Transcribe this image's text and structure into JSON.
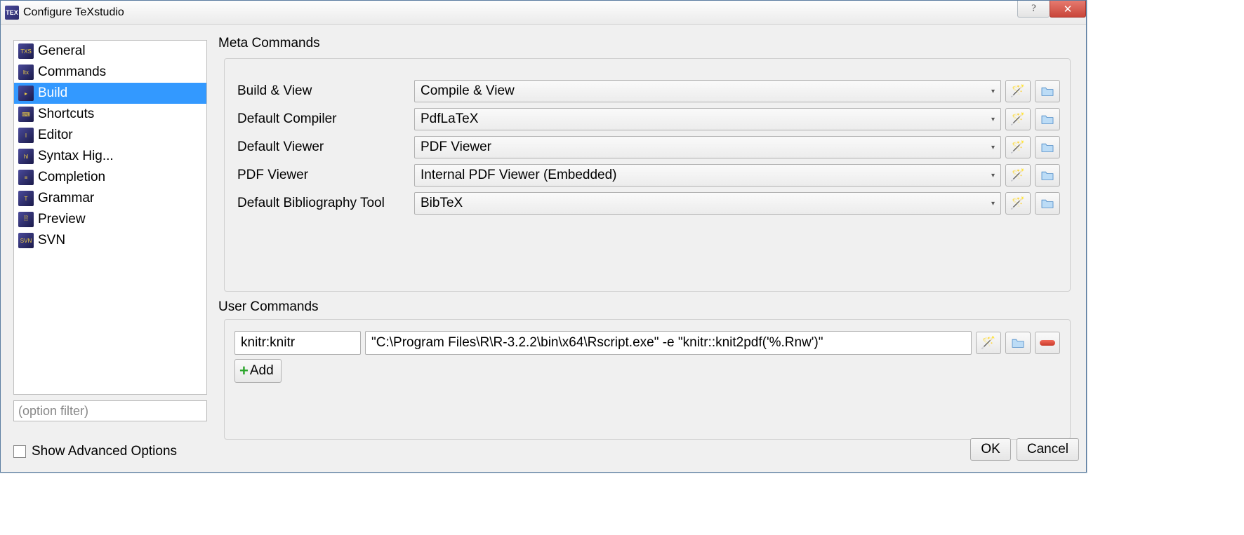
{
  "window": {
    "title": "Configure TeXstudio"
  },
  "sidebar": {
    "items": [
      {
        "label": "General"
      },
      {
        "label": "Commands"
      },
      {
        "label": "Build"
      },
      {
        "label": "Shortcuts"
      },
      {
        "label": "Editor"
      },
      {
        "label": "Syntax Hig..."
      },
      {
        "label": "Completion"
      },
      {
        "label": "Grammar"
      },
      {
        "label": "Preview"
      },
      {
        "label": "SVN"
      }
    ],
    "selected_index": 2,
    "filter_placeholder": "(option filter)"
  },
  "footer": {
    "advanced_label": "Show Advanced Options",
    "ok": "OK",
    "cancel": "Cancel"
  },
  "meta": {
    "title": "Meta Commands",
    "rows": [
      {
        "label": "Build & View",
        "value": "Compile & View"
      },
      {
        "label": "Default Compiler",
        "value": "PdfLaTeX"
      },
      {
        "label": "Default Viewer",
        "value": "PDF Viewer"
      },
      {
        "label": "PDF Viewer",
        "value": "Internal PDF Viewer (Embedded)"
      },
      {
        "label": "Default Bibliography Tool",
        "value": "BibTeX"
      }
    ]
  },
  "user": {
    "title": "User Commands",
    "rows": [
      {
        "name": "knitr:knitr",
        "cmd": "\"C:\\Program Files\\R\\R-3.2.2\\bin\\x64\\Rscript.exe\" -e \"knitr::knit2pdf('%.Rnw')\""
      }
    ],
    "add_label": "Add"
  }
}
